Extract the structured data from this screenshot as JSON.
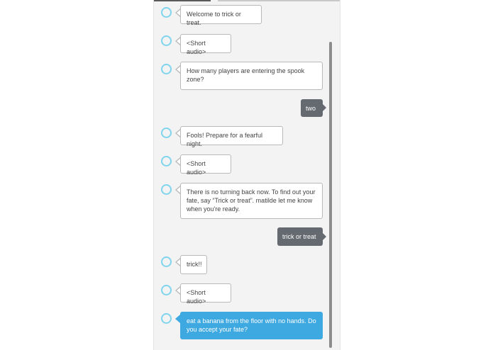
{
  "conversation": {
    "messages": [
      {
        "speaker": "alexa",
        "text": "Welcome to trick or treat."
      },
      {
        "speaker": "alexa",
        "text": "<Short audio>"
      },
      {
        "speaker": "alexa",
        "text": "How many players are entering the spook zone?"
      },
      {
        "speaker": "user",
        "text": "two"
      },
      {
        "speaker": "alexa",
        "text": "Fools! Prepare for a fearful night."
      },
      {
        "speaker": "alexa",
        "text": "<Short audio>"
      },
      {
        "speaker": "alexa",
        "text": "There is no turning back now. To find out your fate, say “Trick or treat”. matilde let me know when you're ready."
      },
      {
        "speaker": "user",
        "text": "trick or treat"
      },
      {
        "speaker": "alexa",
        "text": "trick!!"
      },
      {
        "speaker": "alexa",
        "text": "<Short audio>"
      },
      {
        "speaker": "alexa",
        "text": "eat a banana from the floor with no hands. Do you accept your fate?",
        "highlighted": true
      }
    ]
  },
  "colors": {
    "alexa_bubble_border": "#b9b9b9",
    "user_bubble": "#656a70",
    "highlight_bubble": "#3ea8e0",
    "alexa_ring": "#7fd5ee"
  },
  "icons": {
    "alexa_avatar": "alexa-ring-icon"
  }
}
